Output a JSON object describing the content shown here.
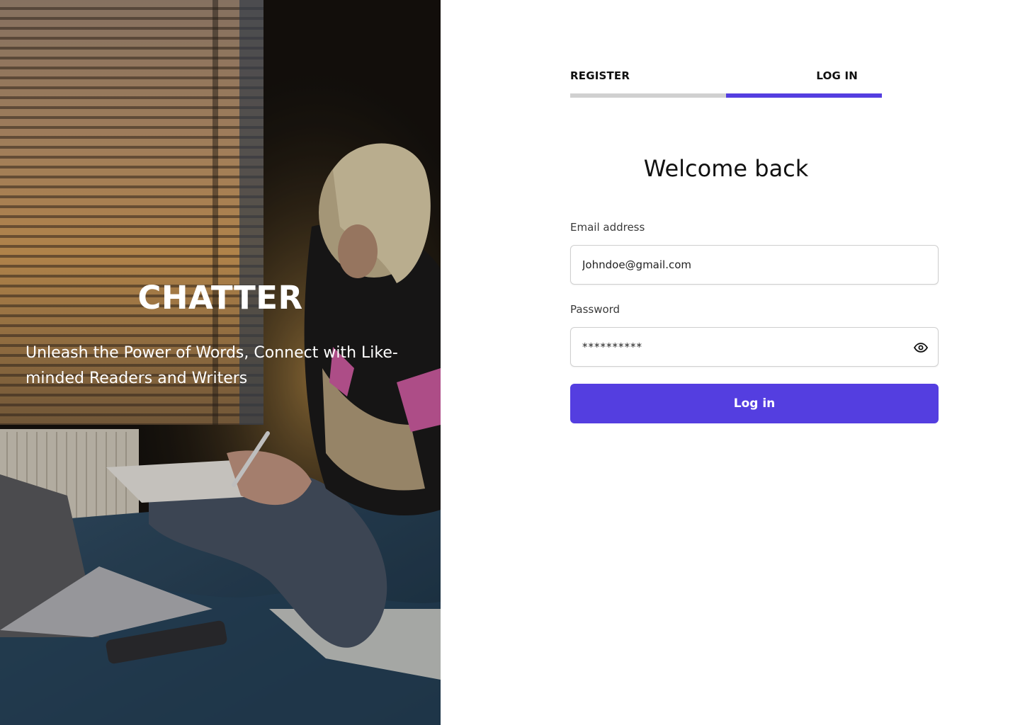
{
  "hero": {
    "brand": "CHATTER",
    "tagline": "Unleash the Power of Words, Connect with Like-minded Readers and Writers",
    "photo": "person-writing-in-notebook-on-bed-near-window-blinds"
  },
  "tabs": [
    {
      "label": "REGISTER",
      "active": false
    },
    {
      "label": "LOG IN",
      "active": true
    }
  ],
  "heading": "Welcome back",
  "email": {
    "label": "Email address",
    "value": "Johndoe@gmail.com"
  },
  "password": {
    "label": "Password",
    "value": "**********",
    "toggle_icon": "eye-icon"
  },
  "submit": {
    "label": "Log in"
  },
  "colors": {
    "accent": "#543ee0",
    "inactive_tab_bar": "#d0d0d0",
    "text": "#111111"
  }
}
